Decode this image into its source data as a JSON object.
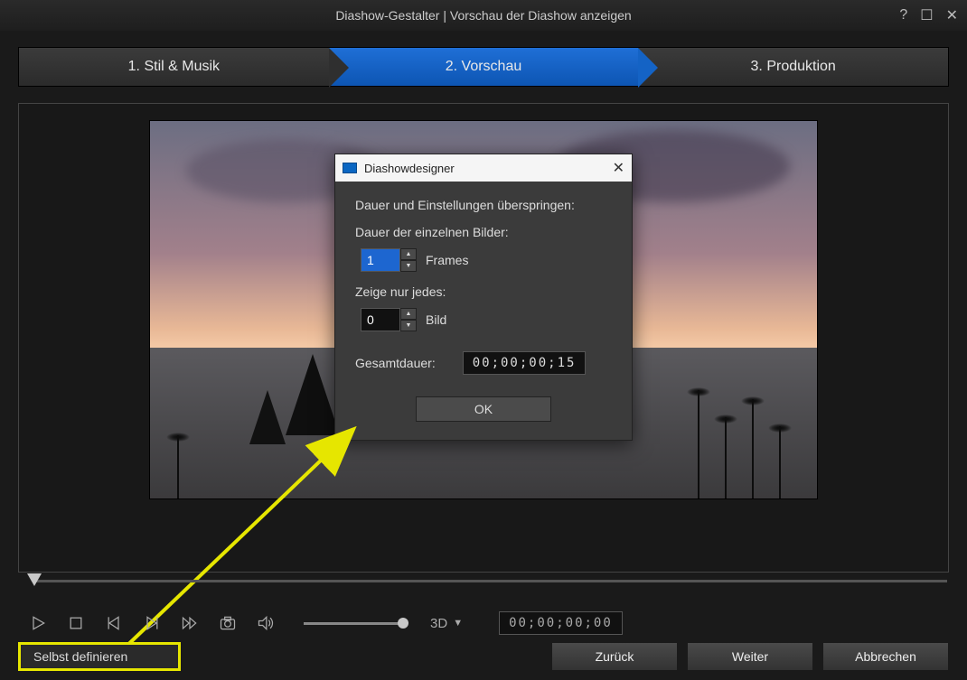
{
  "title": "Diashow-Gestalter | Vorschau der Diashow anzeigen",
  "steps": {
    "s1": "1. Stil & Musik",
    "s2": "2. Vorschau",
    "s3": "3. Produktion"
  },
  "dialog": {
    "title": "Diashowdesigner",
    "heading": "Dauer und Einstellungen überspringen:",
    "duration_label": "Dauer der einzelnen Bilder:",
    "duration_value": "1",
    "duration_unit": "Frames",
    "every_label": "Zeige nur jedes:",
    "every_value": "0",
    "every_unit": "Bild",
    "total_label": "Gesamtdauer:",
    "total_value": "00;00;00;15",
    "ok": "OK"
  },
  "playback": {
    "threeD": "3D",
    "time": "00;00;00;00"
  },
  "bottom": {
    "self_define": "Selbst definieren",
    "back": "Zurück",
    "next": "Weiter",
    "cancel": "Abbrechen"
  }
}
